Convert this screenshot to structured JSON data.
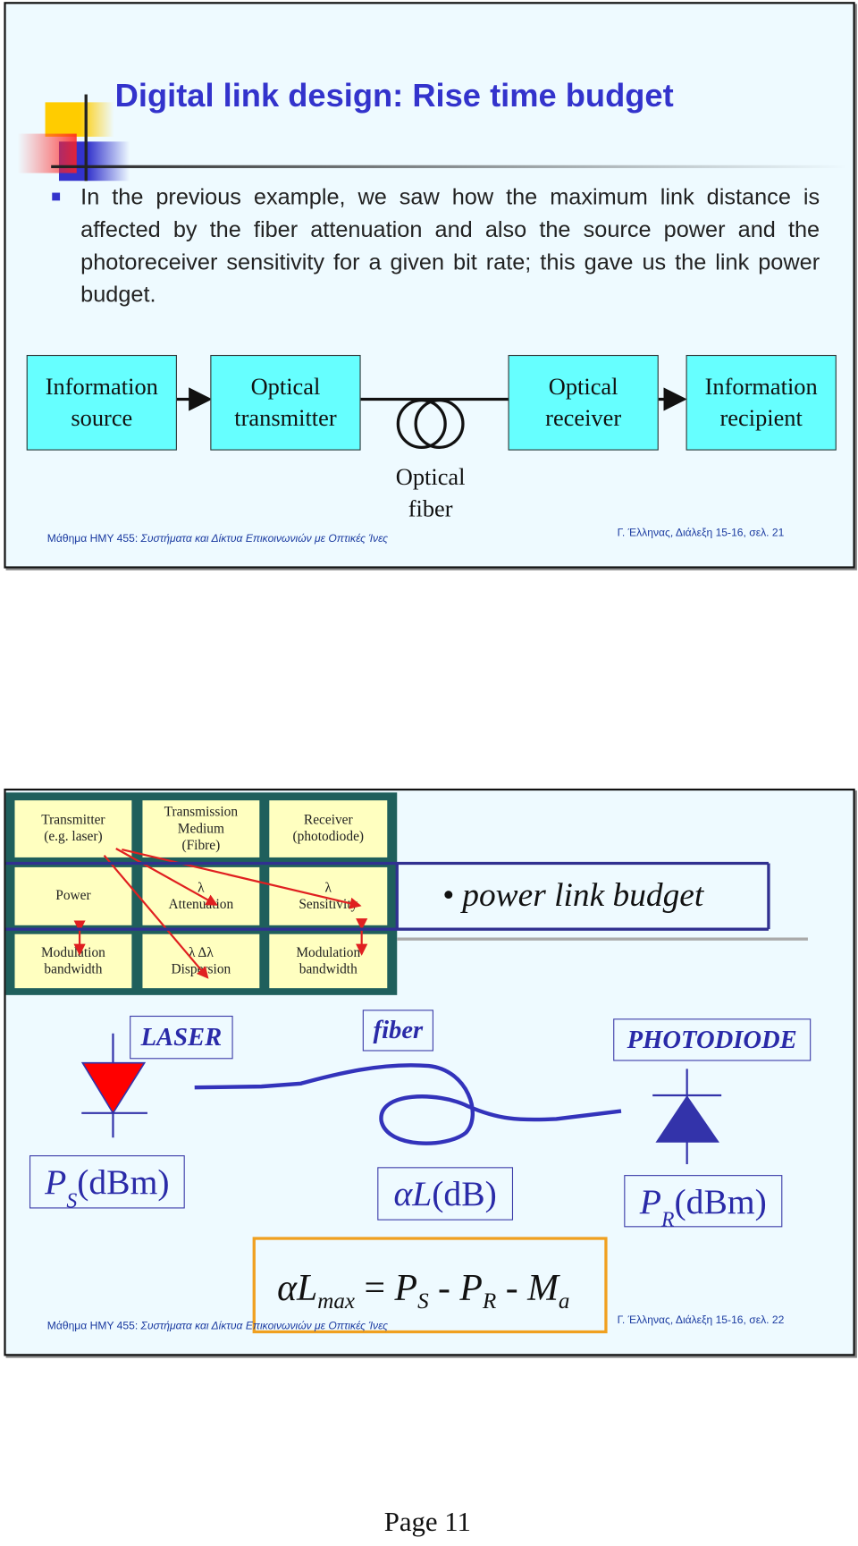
{
  "slide1": {
    "title": "Digital link design: Rise time budget",
    "bullet": "In the previous example, we saw how the maximum link distance is affected by the fiber attenuation and also the source power and the photoreceiver sensitivity for a given bit rate; this gave us the link power budget.",
    "diagram": {
      "box1_l1": "Information",
      "box1_l2": "source",
      "box2_l1": "Optical",
      "box2_l2": "transmitter",
      "box3_l1": "Optical",
      "box3_l2": "receiver",
      "box4_l1": "Information",
      "box4_l2": "recipient",
      "fiber_l1": "Optical",
      "fiber_l2": "fiber"
    },
    "footer_left_a": "Μάθημα ΗΜΥ 455: ",
    "footer_left_b": "Συστήματα και Δίκτυα Επικοινωνιών με Οπτικές Ίνες",
    "footer_right": "Γ. Έλληνας, Διάλεξη 15-16,   σελ. 21"
  },
  "slide2": {
    "table": [
      [
        "Transmitter (e.g. laser)",
        "Transmission Medium (Fibre)",
        "Receiver (photodiode)"
      ],
      [
        "Power",
        "λ Attenuation",
        "λ Sensitivity"
      ],
      [
        "Modulation bandwidth",
        "λ  Δλ Dispersion",
        "Modulation bandwidth"
      ]
    ],
    "cells": {
      "c00a": "Transmitter",
      "c00b": "(e.g. laser)",
      "c01a": "Transmission",
      "c01b": "Medium",
      "c01c": "(Fibre)",
      "c02a": "Receiver",
      "c02b": "(photodiode)",
      "c10": "Power",
      "c11a": "λ",
      "c11b": "Attenuation",
      "c12a": "λ",
      "c12b": "Sensitivity",
      "c20a": "Modulation",
      "c20b": "bandwidth",
      "c21a": "λ    Δλ",
      "c21b": "Dispersion",
      "c22a": "Modulation",
      "c22b": "bandwidth"
    },
    "power_link_budget": "• power link budget",
    "laser_label": "LASER",
    "fiber_label": "fiber",
    "photodiode_label": "PHOTODIODE",
    "ps": {
      "sym": "P",
      "sub": "S",
      "unit": " (dBm)"
    },
    "al": {
      "sym": "αL",
      "unit": " (dB)"
    },
    "pr": {
      "sym": "P",
      "sub": "R",
      "unit": " (dBm)"
    },
    "formula": {
      "a": "αL",
      "max": "max",
      "eq": " = ",
      "p1": "P",
      "s": "S",
      "m1": " - ",
      "p2": "P",
      "r": "R",
      "m2": " - ",
      "m": "M",
      "sa": "a"
    },
    "footer_left_a": "Μάθημα ΗΜΥ 455: ",
    "footer_left_b": "Συστήματα και Δίκτυα Επικοινωνιών με Οπτικές Ίνες",
    "footer_right": "Γ. Έλληνας, Διάλεξη 15-16,   σελ. 22"
  },
  "page_label": "Page 11",
  "colors": {
    "title": "#3333cc",
    "box": "#66ffff",
    "slide_bg": "#eefaff",
    "laser": "#ff0000",
    "diode": "#3333aa",
    "formula_box": "#f0a020"
  }
}
